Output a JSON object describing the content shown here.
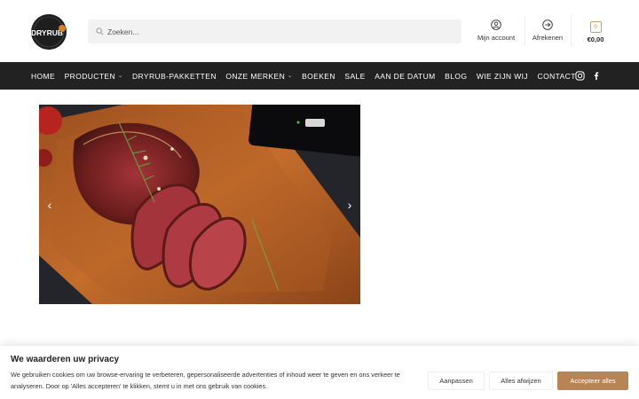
{
  "header": {
    "logo_text": "DRYRUB",
    "search_placeholder": "Zoeken...",
    "account_label": "Mijn account",
    "checkout_label": "Afrekenen",
    "cart_count": "0",
    "cart_total": "€0,00"
  },
  "nav": {
    "items": [
      {
        "label": "HOME"
      },
      {
        "label": "PRODUCTEN"
      },
      {
        "label": "DRYRUB-PAKKETTEN"
      },
      {
        "label": "ONZE MERKEN"
      },
      {
        "label": "BOEKEN"
      },
      {
        "label": "SALE"
      },
      {
        "label": "AAN DE DATUM"
      },
      {
        "label": "BLOG"
      },
      {
        "label": "WIE ZIJN WIJ"
      },
      {
        "label": "CONTACT"
      }
    ]
  },
  "slider": {
    "prev_arrow": "‹",
    "next_arrow": "›"
  },
  "cookie": {
    "title": "We waarderen uw privacy",
    "text": "We gebruiken cookies om uw browse-ervaring te verbeteren, gepersonaliseerde advertenties of inhoud weer te geven en ons verkeer te analyseren. Door op 'Alles accepteren' te klikken, stemt u in met ons gebruik van cookies.",
    "customize_label": "Aanpassen",
    "reject_label": "Alles afwijzen",
    "accept_label": "Accepteer alles"
  },
  "colors": {
    "nav_bg": "#222222",
    "accent": "#b88454"
  },
  "icons": [
    "search-icon",
    "user-icon",
    "arrow-right-circle-icon",
    "shopping-bag-icon",
    "instagram-icon",
    "facebook-icon",
    "chevron-down-icon",
    "chevron-left-icon",
    "chevron-right-icon"
  ]
}
